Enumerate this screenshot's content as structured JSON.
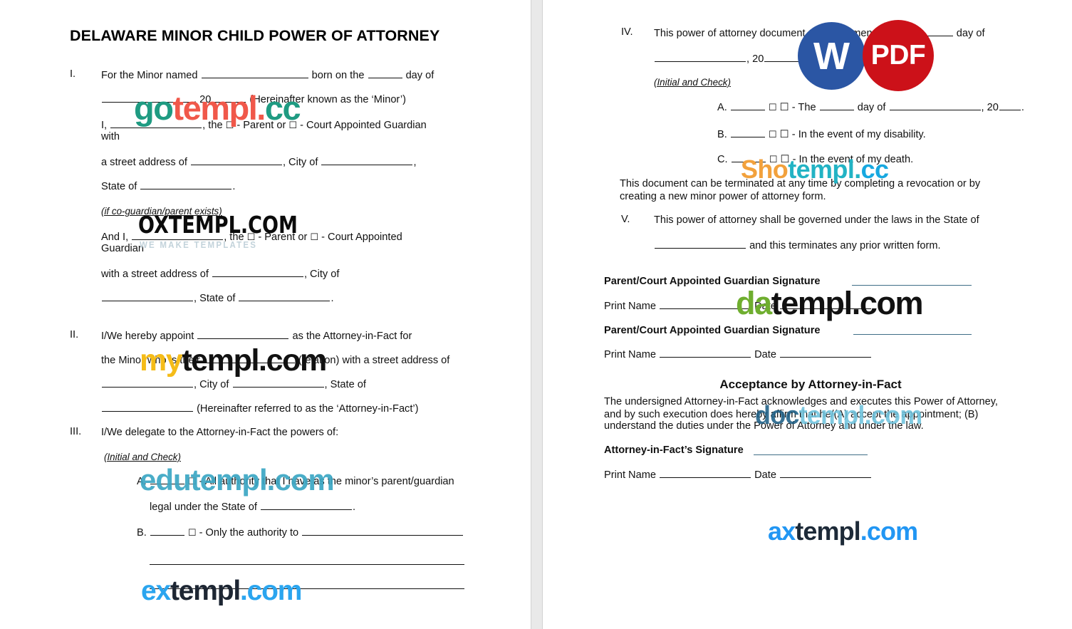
{
  "document": {
    "title": "DELAWARE MINOR CHILD POWER OF ATTORNEY"
  },
  "left_page": {
    "sections": [
      {
        "numeral": "I.",
        "lines": [
          "For the Minor named ____________________ born on the ____ day of",
          "________________, 20_____ (Hereinafter known as the ‘Minor’)",
          "I, ___________________, the ☐ - Parent or ☐ - Court Appointed Guardian with",
          "a street address of ___________________, City of __________________,",
          "State of __________________."
        ]
      },
      {
        "note": "(if co-guardian/parent exists)",
        "lines": [
          "And I, __________________, the ☐ - Parent or ☐ - Court Appointed Guardian",
          "with a street address of __________________, City of",
          "__________________, State of __________________."
        ]
      },
      {
        "numeral": "II.",
        "lines": [
          "I/We hereby appoint __________________ as the Attorney-in-Fact for",
          "the Minor who is their __________________ (relation) with a street address of",
          "__________________, City of __________________, State of",
          "__________________ (Hereinafter referred to as the ‘Attorney-in-Fact’)"
        ]
      },
      {
        "numeral": "III.",
        "lines": [
          "I/We delegate to the Attorney-in-Fact the powers of:"
        ],
        "note": "(Initial and Check)",
        "items": [
          {
            "letter": "A.",
            "text": "____ ☐ - All authority that I have as the minor’s parent/guardian",
            "text_line2": "legal under the State of __________________."
          },
          {
            "letter": "B.",
            "text": "____ ☐ - Only the authority to ______________________________"
          }
        ]
      }
    ],
    "field_labels": {
      "for_minor_named": "For the Minor named",
      "born_on_the": "born on the",
      "day_of": "day of",
      "year_prefix": "20",
      "hereinafter_minor": "(Hereinafter known as the ‘Minor’)",
      "i_comma": "I,",
      "the": ", the",
      "parent_option": "- Parent or",
      "guardian_option": "- Court Appointed Guardian",
      "with": "with",
      "street_address_of": "a street address of",
      "city_of": ", City of",
      "comma": ",",
      "state_of": "State of",
      "period": ".",
      "co_guardian_note": "(if co-guardian/parent exists)",
      "and_i": "And I,",
      "guardian_word": "Guardian",
      "with_street_address_of": "with a street address of",
      "state_of_comma": ", State of",
      "hereby_appoint": "I/We hereby appoint",
      "as_attorney_in_fact_for": "as the Attorney-in-Fact for",
      "minor_who_is_their": "the Minor who is their",
      "relation_street": "(relation) with a street address of",
      "state_of_plain": ", State of",
      "hereinafter_aif": "(Hereinafter referred to as the ‘Attorney-in-Fact’)",
      "delegate_powers": "I/We delegate to the Attorney-in-Fact the powers of:",
      "initial_and_check": "(Initial and Check)",
      "item_a_text": "☐ - All authority that I have as the minor’s parent/guardian",
      "item_a_line2": "legal under the State of",
      "item_b_text": "☐ - Only the authority to"
    }
  },
  "right_page": {
    "sections": [
      {
        "numeral": "IV.",
        "lines": [
          "This power of attorney document shall commence on the ____ day of",
          "________________, 20_____ and"
        ],
        "note": "(Initial and Check)",
        "items": [
          {
            "letter": "A.",
            "text": "____ ☐ - The ____ day of ______________, 20____."
          },
          {
            "letter": "B.",
            "text": "____ ☐ - In the event of my disability."
          },
          {
            "letter": "C.",
            "text": "____ ☐ - In the event of my death."
          }
        ],
        "paragraph": "This document can be terminated at any time by completing a revocation or by creating a new minor power of attorney form."
      },
      {
        "numeral": "V.",
        "lines": [
          "This power of attorney shall be governed under the laws in the State of",
          "__________________ and this terminates any prior written form."
        ]
      }
    ],
    "field_labels": {
      "commence_line": "This power of attorney document shall commence on the",
      "day_of": "day of",
      "year_prefix": "20",
      "and": "and",
      "initial_and_check": "(Initial and Check)",
      "item_a": "☐ - The",
      "item_a_day_of": "day of",
      "item_b": "☐ - In the event of my disability.",
      "item_c": "☐ - In the event of my death.",
      "termination_paragraph_l1": "This document can be terminated at any time by completing a revocation or by",
      "termination_paragraph_l2": "creating a new minor power of attorney form.",
      "governed_line": "This power of attorney shall be governed under the laws in the State of",
      "terminates_prior": "and this terminates any prior written form."
    },
    "signatures": {
      "guardian_signature_label_1": "Parent/Court Appointed Guardian Signature",
      "print_name_label_1": "Print Name",
      "date_label_1": "Date",
      "guardian_signature_label_2": "Parent/Court Appointed Guardian Signature",
      "print_name_label_2": "Print Name",
      "date_label_2": "Date"
    },
    "acceptance": {
      "heading": "Acceptance by Attorney-in-Fact",
      "body_l1": "The undersigned Attorney-in-Fact acknowledges and executes this Power of Attorney,",
      "body_l2": "and by such execution does hereby affirm that he/(A) accept the appointment; (B)",
      "body_l3": "understand the duties under the Power of Attorney and under the law.",
      "signature_label": "Attorney-in-Fact’s Signature",
      "print_name_label": "Print Name",
      "date_label": "Date"
    }
  },
  "badges": [
    {
      "name": "word-badge",
      "label": "W",
      "color": "#2b56a4"
    },
    {
      "name": "pdf-badge",
      "label": "PDF",
      "color": "#cc1119"
    }
  ],
  "watermarks": [
    {
      "name": "gotempl",
      "part_a": "go",
      "part_b": "templ.",
      "part_c": "cc",
      "color_a": "#1f9b82",
      "color_b": "#f0584a"
    },
    {
      "name": "oxtempl",
      "text": "OXTEMPL.COM",
      "tagline": "WE MAKE TEMPLATES",
      "color": "#0b0b0b",
      "tagline_color": "#c3d3db"
    },
    {
      "name": "mytempl",
      "part_a": "my",
      "part_b": "templ.com",
      "color_a": "#f5bc18",
      "color_b": "#111111"
    },
    {
      "name": "edutempl",
      "text": "edutempl.com",
      "color": "#3ba7c4"
    },
    {
      "name": "extempl",
      "part_a": "ex",
      "part_b": "templ",
      "part_c": ".com",
      "color_a": "#2aa5ef",
      "color_b": "#1d2633"
    },
    {
      "name": "shotempl",
      "part_a": "Sho",
      "part_b": "templ.",
      "part_c": "cc",
      "color_a": "#f2a13c",
      "color_b": "#22b3c4",
      "color_c": "#17a8e0"
    },
    {
      "name": "datempl",
      "part_a": "da",
      "part_b": "templ.com",
      "color_a": "#6fae2f",
      "color_b": "#111111"
    },
    {
      "name": "doctempl",
      "part_a": "doc",
      "part_b": "templ",
      "part_c": ".com",
      "color_a": "#1d5f86",
      "color_b": "#6fc3dd"
    },
    {
      "name": "axtempl",
      "part_a": "ax",
      "part_b": "templ",
      "part_c": ".com",
      "color_a": "#2196f3",
      "color_b": "#1d2a38"
    }
  ]
}
